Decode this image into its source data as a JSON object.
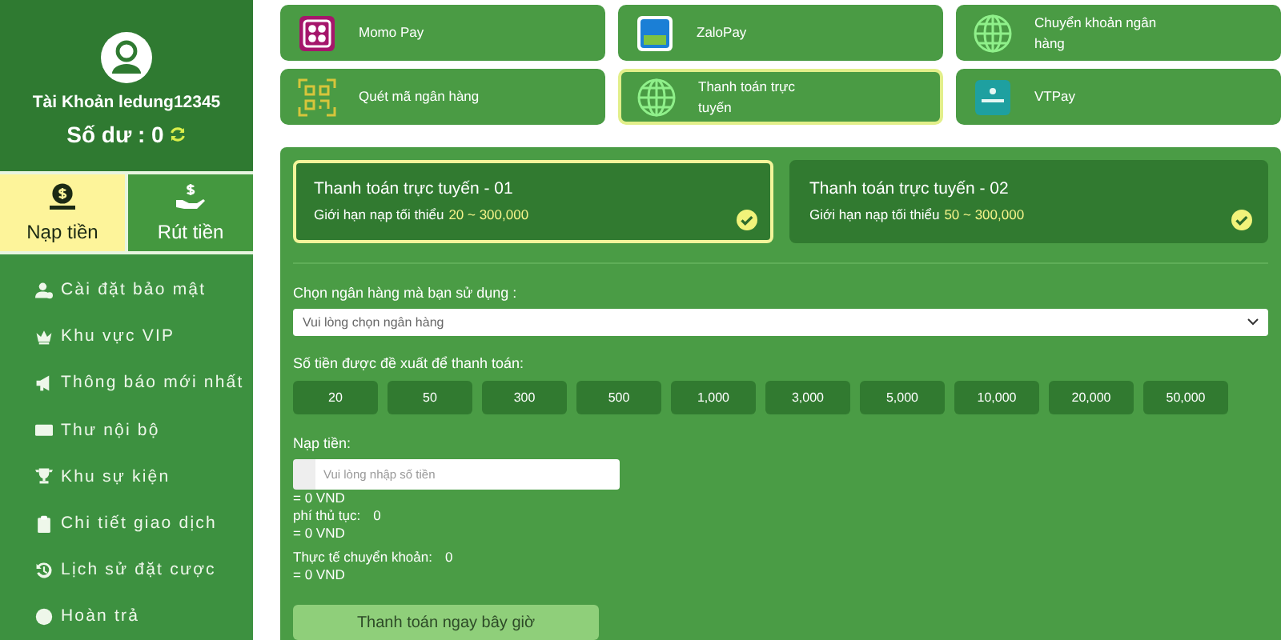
{
  "sidebar": {
    "account": "Tài Khoản ledung12345",
    "balance_label": "Số dư : 0",
    "tabs": [
      {
        "label": "Nạp tiền",
        "selected": true
      },
      {
        "label": "Rút tiền",
        "selected": false
      }
    ],
    "menu": [
      "Cài đặt bảo mật",
      "Khu vực VIP",
      "Thông báo mới nhất",
      "Thư nội bộ",
      "Khu sự kiện",
      "Chi tiết giao dịch",
      "Lịch sử đặt cược",
      "Hoàn trả"
    ]
  },
  "methods": [
    {
      "label": "Momo Pay",
      "selected": false
    },
    {
      "label": "ZaloPay",
      "selected": false
    },
    {
      "label": "Chuyển khoản ngân hàng",
      "selected": false
    },
    {
      "label": "Quét mã ngân hàng",
      "selected": false
    },
    {
      "label": "Thanh toán trực tuyến",
      "selected": true
    },
    {
      "label": "VTPay",
      "selected": false
    }
  ],
  "channels": [
    {
      "title": "Thanh toán trực tuyến - 01",
      "limit_label": "Giới hạn nạp tối thiểu",
      "range": "20 ~ 300,000",
      "selected": true
    },
    {
      "title": "Thanh toán trực tuyến - 02",
      "limit_label": "Giới hạn nạp tối thiểu",
      "range": "50 ~ 300,000",
      "selected": false
    }
  ],
  "bank": {
    "label": "Chọn ngân hàng mà bạn sử dụng :",
    "placeholder": "Vui lòng chọn ngân hàng"
  },
  "amounts": {
    "label": "Số tiền được đề xuất để thanh toán:",
    "options": [
      "20",
      "50",
      "300",
      "500",
      "1,000",
      "3,000",
      "5,000",
      "10,000",
      "20,000",
      "50,000"
    ]
  },
  "deposit": {
    "label": "Nạp tiền:",
    "placeholder": "Vui lòng nhập số tiền",
    "converted": "= 0 VND",
    "fee_label": "phí thủ tục:",
    "fee": "0",
    "fee_converted": "= 0 VND",
    "actual_label": "Thực tế chuyển khoản:",
    "actual": "0",
    "actual_converted": "= 0 VND"
  },
  "submit": {
    "label": "Thanh toán ngay bây giờ",
    "disabled": true
  }
}
